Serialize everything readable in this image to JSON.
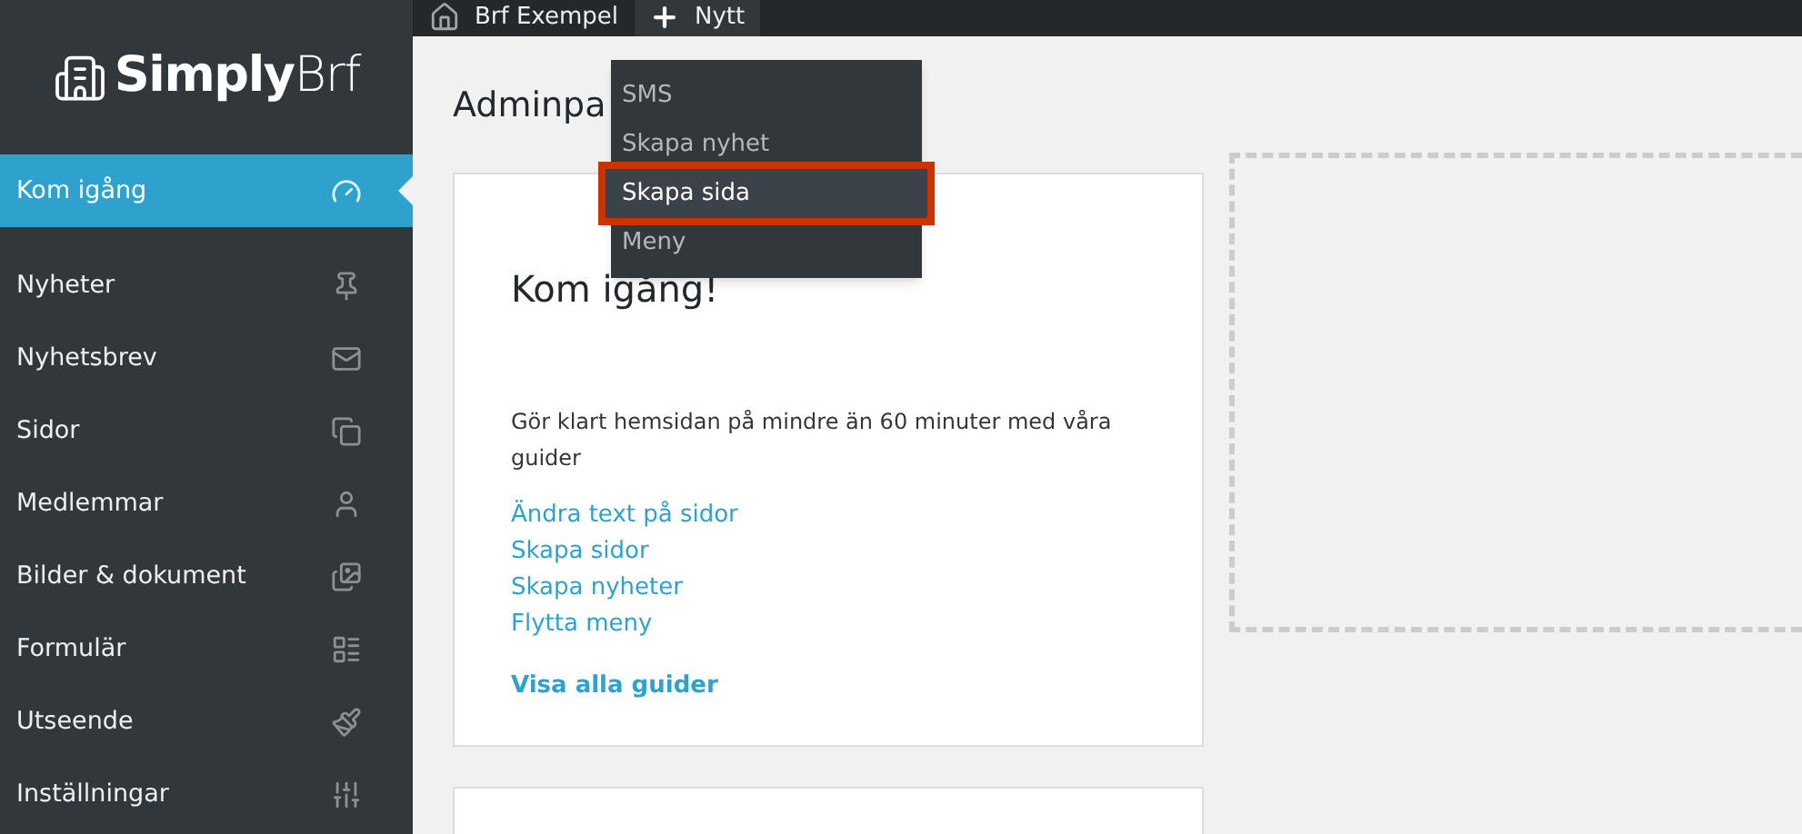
{
  "logo": {
    "text_bold": "Simply",
    "text_light": "Brf"
  },
  "topbar": {
    "site": "Brf Exempel",
    "new": "Nytt"
  },
  "new_menu": [
    {
      "label": "SMS",
      "selected": false
    },
    {
      "label": "Skapa nyhet",
      "selected": false
    },
    {
      "label": "Skapa sida",
      "selected": true
    },
    {
      "label": "Meny",
      "selected": false
    }
  ],
  "sidebar": {
    "items": [
      {
        "label": "Kom igång",
        "selected": true
      },
      {
        "label": "Nyheter",
        "selected": false
      },
      {
        "label": "Nyhetsbrev",
        "selected": false
      },
      {
        "label": "Sidor",
        "selected": false
      },
      {
        "label": "Medlemmar",
        "selected": false
      },
      {
        "label": "Bilder & dokument",
        "selected": false
      },
      {
        "label": "Formulär",
        "selected": false
      },
      {
        "label": "Utseende",
        "selected": false
      },
      {
        "label": "Inställningar",
        "selected": false
      }
    ]
  },
  "page_title": "Adminpa",
  "card": {
    "title": "Kom igång!",
    "text": "Gör klart hemsidan på mindre än 60 minuter med våra guider",
    "links": [
      "Ändra text på sidor",
      "Skapa sidor",
      "Skapa nyheter",
      "Flytta meny"
    ],
    "all_link": "Visa alla guider"
  }
}
